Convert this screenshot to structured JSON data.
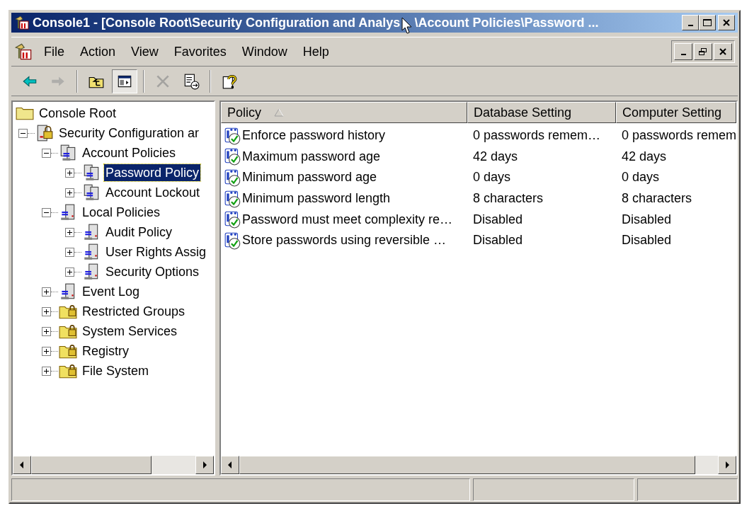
{
  "window": {
    "title": [
      "Console1 - [Console Root\\Security Configuration and Analys",
      "\\Account Policies\\Password ..."
    ]
  },
  "menu": [
    "File",
    "Action",
    "View",
    "Favorites",
    "Window",
    "Help"
  ],
  "toolbar": [
    {
      "kind": "back",
      "disabled": false,
      "pressed": false
    },
    {
      "kind": "forward",
      "disabled": true,
      "pressed": false
    },
    {
      "kind": "up",
      "disabled": false,
      "pressed": false
    },
    {
      "kind": "tree",
      "disabled": false,
      "pressed": true
    },
    {
      "kind": "delete",
      "disabled": true,
      "pressed": false
    },
    {
      "kind": "export",
      "disabled": false,
      "pressed": false
    },
    {
      "kind": "help",
      "disabled": false,
      "pressed": false
    }
  ],
  "tree": [
    {
      "label": "Console Root",
      "kind": "folder",
      "selected": false,
      "children": [
        {
          "label": "Security Configuration ar",
          "kind": "security",
          "selected": false,
          "expanded": true,
          "children": [
            {
              "label": "Account Policies",
              "kind": "group",
              "selected": false,
              "expanded": true,
              "children": [
                {
                  "label": "Password Policy",
                  "kind": "group",
                  "selected": true,
                  "expanded": false
                },
                {
                  "label": "Account Lockout",
                  "kind": "group",
                  "selected": false,
                  "expanded": false
                }
              ]
            },
            {
              "label": "Local Policies",
              "kind": "server",
              "selected": false,
              "expanded": true,
              "children": [
                {
                  "label": "Audit Policy",
                  "kind": "server",
                  "selected": false,
                  "expanded": false
                },
                {
                  "label": "User Rights Assig",
                  "kind": "server",
                  "selected": false,
                  "expanded": false
                },
                {
                  "label": "Security Options",
                  "kind": "server",
                  "selected": false,
                  "expanded": false
                }
              ]
            },
            {
              "label": "Event Log",
              "kind": "server",
              "selected": false,
              "expanded": false
            },
            {
              "label": "Restricted Groups",
              "kind": "locked-folder",
              "selected": false,
              "expanded": false
            },
            {
              "label": "System Services",
              "kind": "locked-folder",
              "selected": false,
              "expanded": false
            },
            {
              "label": "Registry",
              "kind": "locked-folder",
              "selected": false,
              "expanded": false
            },
            {
              "label": "File System",
              "kind": "locked-folder",
              "selected": false,
              "expanded": false
            }
          ]
        }
      ]
    }
  ],
  "table": {
    "columns": [
      {
        "label": "Policy",
        "sorted": true
      },
      {
        "label": "Database Setting",
        "sorted": false
      },
      {
        "label": "Computer Setting",
        "sorted": false
      }
    ],
    "rows": [
      [
        "Enforce password history",
        "0 passwords remem…",
        "0 passwords remem"
      ],
      [
        "Maximum password age",
        "42 days",
        "42 days"
      ],
      [
        "Minimum password age",
        "0 days",
        "0 days"
      ],
      [
        "Minimum password length",
        "8 characters",
        "8 characters"
      ],
      [
        "Password must meet complexity re…",
        "Disabled",
        "Disabled"
      ],
      [
        "Store passwords using reversible …",
        "Disabled",
        "Disabled"
      ]
    ]
  }
}
